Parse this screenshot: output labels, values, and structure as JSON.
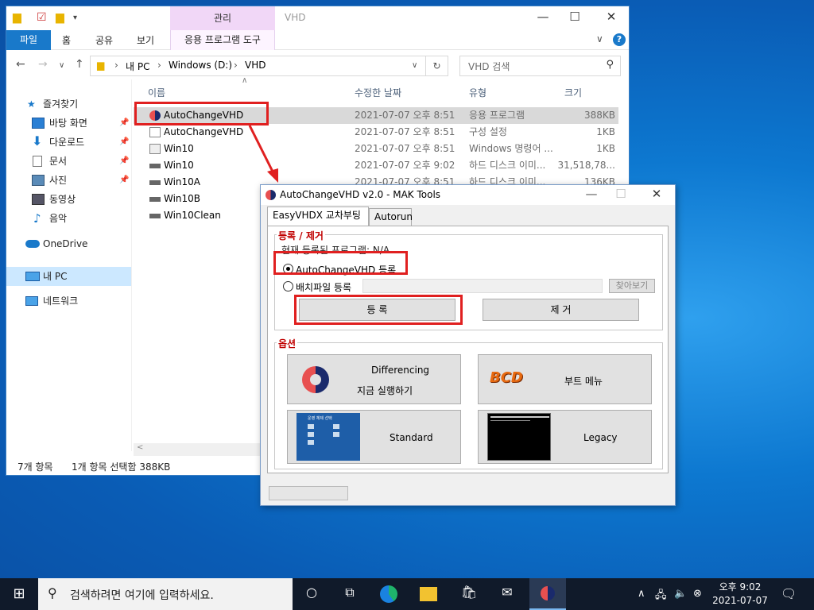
{
  "explorer": {
    "title": "VHD",
    "context_tab": "관리",
    "ribbon_tabs": [
      "파일",
      "홈",
      "공유",
      "보기"
    ],
    "app_tools_tab": "응용 프로그램 도구",
    "address": {
      "root": "내 PC",
      "drive": "Windows (D:)",
      "folder": "VHD"
    },
    "search_placeholder": "VHD 검색",
    "columns": {
      "name": "이름",
      "date": "수정한 날짜",
      "type": "유형",
      "size": "크기"
    },
    "sidebar": {
      "quick_access": "즐겨찾기",
      "items": [
        "바탕 화면",
        "다운로드",
        "문서",
        "사진",
        "동영상",
        "음악"
      ],
      "onedrive": "OneDrive",
      "this_pc": "내 PC",
      "network": "네트워크"
    },
    "files": [
      {
        "name": "AutoChangeVHD",
        "date": "2021-07-07 오후 8:51",
        "type": "응용 프로그램",
        "size": "388KB",
        "icon": "app-icon"
      },
      {
        "name": "AutoChangeVHD",
        "date": "2021-07-07 오후 8:51",
        "type": "구성 설정",
        "size": "1KB",
        "icon": "config-icon"
      },
      {
        "name": "Win10",
        "date": "2021-07-07 오후 8:51",
        "type": "Windows 명령어 ...",
        "size": "1KB",
        "icon": "batch-icon"
      },
      {
        "name": "Win10",
        "date": "2021-07-07 오후 9:02",
        "type": "하드 디스크 이미...",
        "size": "31,518,78...",
        "icon": "disk-icon"
      },
      {
        "name": "Win10A",
        "date": "2021-07-07 오후 8:51",
        "type": "하드 디스크 이미...",
        "size": "136KB",
        "icon": "disk-icon"
      },
      {
        "name": "Win10B",
        "date": "",
        "type": "",
        "size": "",
        "icon": "disk-icon"
      },
      {
        "name": "Win10Clean",
        "date": "",
        "type": "",
        "size": "",
        "icon": "disk-icon"
      }
    ],
    "status": {
      "count": "7개 항목",
      "selection": "1개 항목 선택함 388KB"
    }
  },
  "dialog": {
    "title": "AutoChangeVHD v2.0 - MAK Tools",
    "tabs": [
      "EasyVHDX 교차부팅",
      "Autorun"
    ],
    "register_group": {
      "title": "등록 / 제거",
      "current": "현재 등록된 프로그램: N/A",
      "radio1": "AutoChangeVHD 등록",
      "radio2": "배치파일 등록",
      "browse": "찾아보기",
      "register_btn": "등 록",
      "remove_btn": "제 거"
    },
    "options_group": {
      "title": "옵션",
      "differencing_line1": "Differencing",
      "differencing_line2": "지금 실행하기",
      "bcd_logo": "BCD",
      "boot_menu": "부트 메뉴",
      "standard": "Standard",
      "legacy": "Legacy",
      "standard_thumb_title": "운영 체제 선택"
    }
  },
  "taskbar": {
    "search_placeholder": "검색하려면 여기에 입력하세요.",
    "time": "오후 9:02",
    "date": "2021-07-07"
  },
  "colors": {
    "accent": "#1979ca",
    "highlight": "#e02020",
    "group_title": "#c00000"
  }
}
